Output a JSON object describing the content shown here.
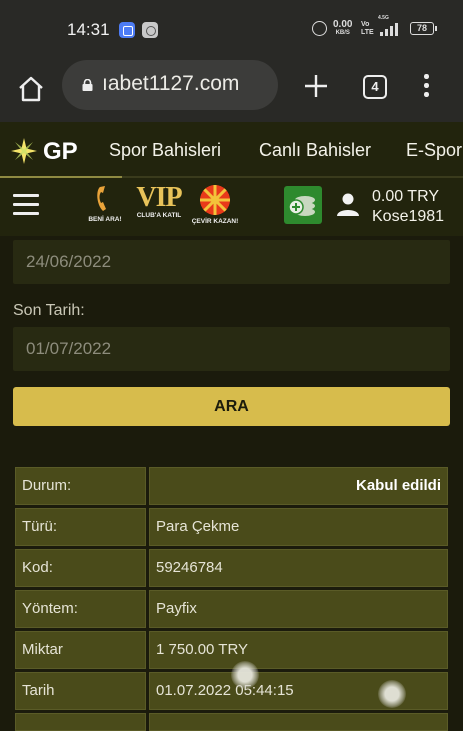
{
  "status_bar": {
    "time": "14:31",
    "net_speed": "0.00",
    "net_unit": "KB/S",
    "volte_top": "Vo",
    "volte_bottom": "LTE",
    "signal_label": "4.5G",
    "battery": "78"
  },
  "browser": {
    "url": "ıabet1127.com",
    "tab_count": "4",
    "icons": [
      "home-icon",
      "lock-icon",
      "plus-icon",
      "tabs-icon",
      "more-vert-icon"
    ]
  },
  "site_nav": {
    "logo_text": "GP",
    "tabs": [
      "Spor Bahisleri",
      "Canlı Bahisler",
      "E-Spor"
    ]
  },
  "promo": {
    "call_label": "BENİ ARA!",
    "vip_text": "VIP",
    "vip_label": "CLUB'A KATIL",
    "spin_label": "ÇEVİR KAZAN!"
  },
  "account": {
    "balance": "0.00 TRY",
    "username": "Kose1981"
  },
  "filter": {
    "start_date_value": "24/06/2022",
    "end_label": "Son Tarih:",
    "end_date_value": "01/07/2022",
    "search_button": "ARA"
  },
  "transaction": {
    "rows": [
      {
        "label": "Durum:",
        "value": "Kabul edildi"
      },
      {
        "label": "Türü:",
        "value": "Para Çekme"
      },
      {
        "label": "Kod:",
        "value": "59246784"
      },
      {
        "label": "Yöntem:",
        "value": "Payfix"
      },
      {
        "label": "Miktar",
        "value": "1 750.00 TRY"
      },
      {
        "label": "Tarih",
        "value": "01.07.2022 05:44:15"
      }
    ]
  },
  "colors": {
    "background": "#1b1b0c",
    "header": "#22240d",
    "accent_button": "#d7bc4c",
    "table_cell": "#4a4b1a",
    "wallet": "#2e8a2e"
  }
}
